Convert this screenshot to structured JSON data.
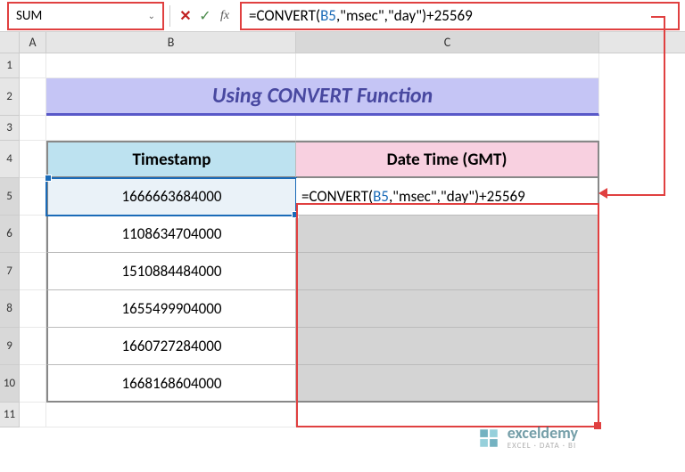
{
  "nameBox": "SUM",
  "formulaBar": {
    "prefix": "=CONVERT(",
    "ref": "B5",
    "mid": ",\"msec\",\"day\")",
    "suffix": "+25569"
  },
  "columns": {
    "A": "A",
    "B": "B",
    "C": "C"
  },
  "rows": [
    "1",
    "2",
    "3",
    "4",
    "5",
    "6",
    "7",
    "8",
    "9",
    "10",
    "11"
  ],
  "title": "Using CONVERT Function",
  "headers": {
    "b": "Timestamp",
    "c": "Date Time (GMT)"
  },
  "data": {
    "b5": "1666663684000",
    "b6": "1108634704000",
    "b7": "1510884484000",
    "b8": "1655499904000",
    "b9": "1660727284000",
    "b10": "1668168604000"
  },
  "cellFormula": {
    "prefix": "=CONVERT(",
    "ref": "B5",
    "mid": ",\"msec\",\"day\")+25569"
  },
  "watermark": {
    "name": "exceldemy",
    "tag": "EXCEL · DATA · BI"
  }
}
